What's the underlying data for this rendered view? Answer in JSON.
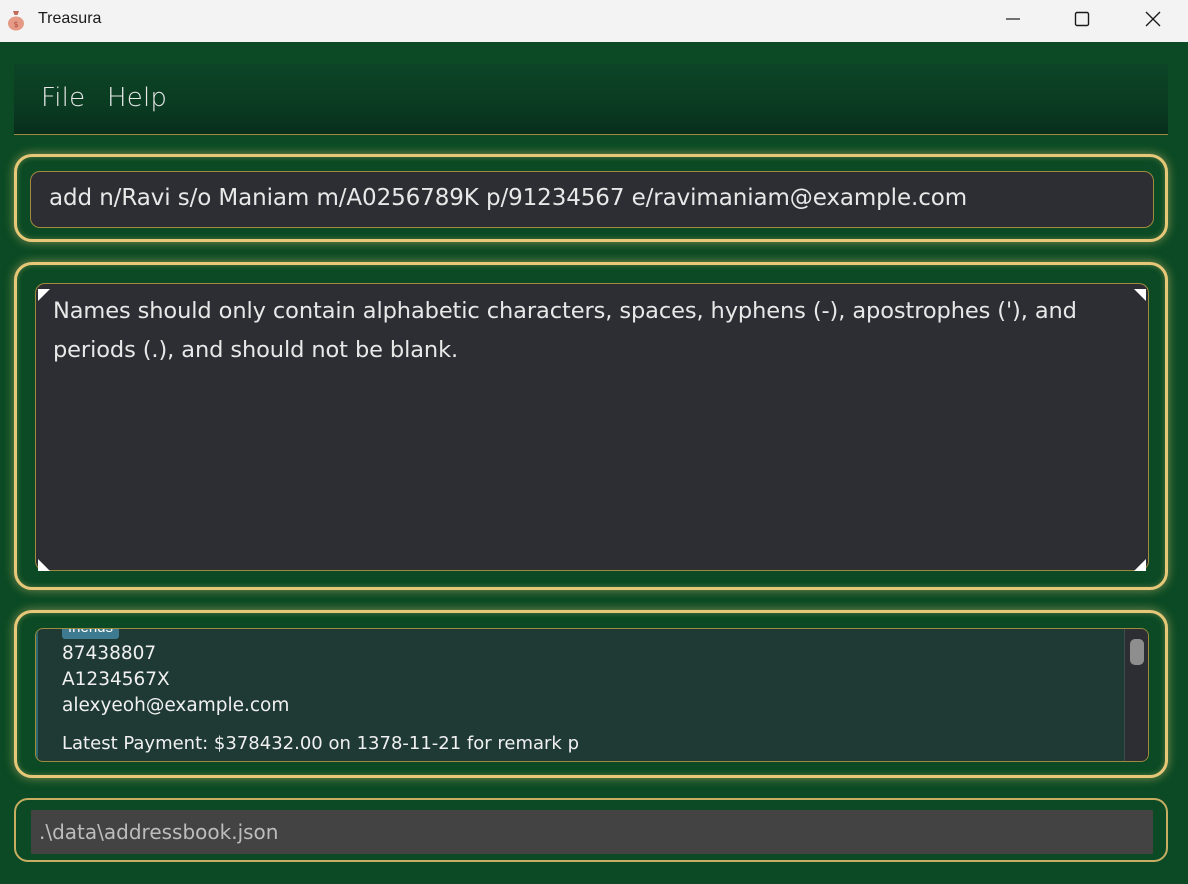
{
  "window": {
    "title": "Treasura",
    "app_icon": "money-bag-icon",
    "controls": [
      "minimize-icon",
      "maximize-icon",
      "close-icon"
    ]
  },
  "menu": {
    "items": [
      {
        "label": "File"
      },
      {
        "label": "Help"
      }
    ]
  },
  "command": {
    "value": "add n/Ravi s/o Maniam m/A0256789K p/91234567 e/ravimaniam@example.com"
  },
  "result": {
    "message": "Names should only contain alphabetic characters, spaces, hyphens (-), apostrophes ('), and periods (.), and should not be blank."
  },
  "person_list": {
    "visible_card": {
      "tag": "friends",
      "phone": "87438807",
      "matric": "A1234567X",
      "email": "alexyeoh@example.com",
      "latest_payment": "Latest Payment: $378432.00 on 1378-11-21 for remark p"
    }
  },
  "status_bar": {
    "path": ".\\data\\addressbook.json"
  },
  "colors": {
    "background": "#0b4a24",
    "panel_border": "#e6c878",
    "box_background": "#2d2e33",
    "list_background": "#1f3a34",
    "tag_background": "#3e7b91"
  }
}
